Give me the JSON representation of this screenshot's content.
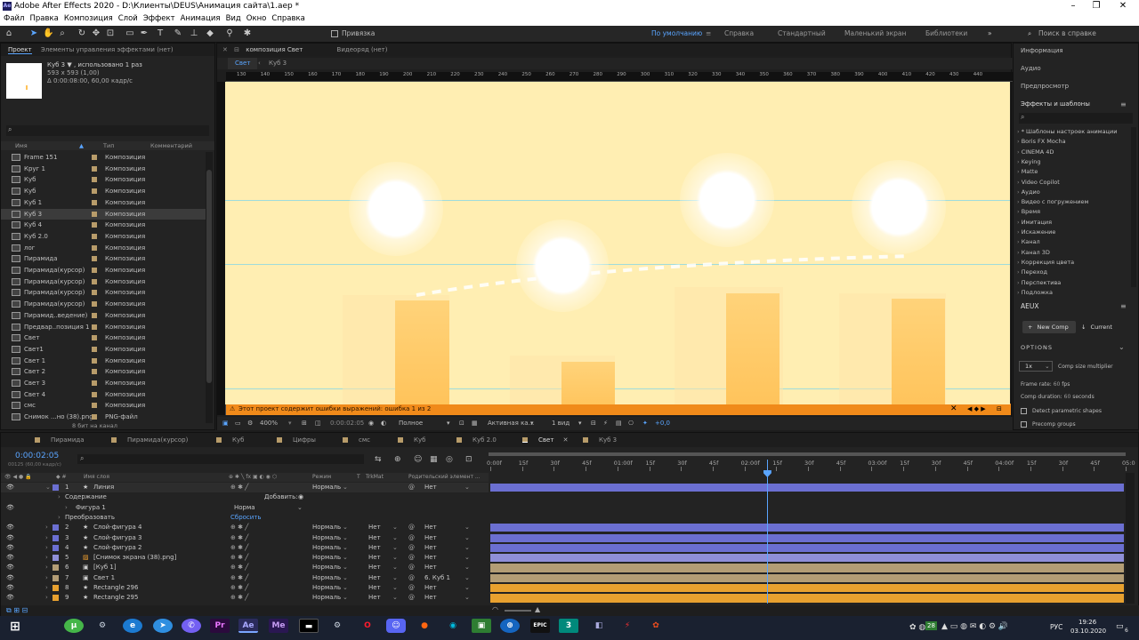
{
  "window": {
    "title": "Adobe After Effects 2020 - D:\\Клиенты\\DEUS\\Анимация сайта\\1.aep *"
  },
  "menu": [
    "Файл",
    "Правка",
    "Композиция",
    "Слой",
    "Эффект",
    "Анимация",
    "Вид",
    "Окно",
    "Справка"
  ],
  "toolbar": {
    "snap_label": "Привязка",
    "workspaces": [
      "По умолчанию",
      "Справка",
      "Стандартный",
      "Маленький экран",
      "Библиотеки"
    ],
    "search_placeholder": "Поиск в справке"
  },
  "project_panel": {
    "tabs": [
      "Проект",
      "Элементы управления эффектами (нет)"
    ],
    "selected_name": "Куб 3 ▼ , использовано 1 раз",
    "selected_dims": "593 x 593 (1,00)",
    "selected_duration": "Δ 0:00:08:00, 60,00 кадр/с",
    "columns": [
      "Имя",
      "Тип",
      "Комментарий"
    ],
    "items": [
      {
        "name": "Frame 151",
        "type": "Композиция"
      },
      {
        "name": "Круг 1",
        "type": "Композиция"
      },
      {
        "name": "Куб",
        "type": "Композиция"
      },
      {
        "name": "Куб",
        "type": "Композиция"
      },
      {
        "name": "Куб 1",
        "type": "Композиция"
      },
      {
        "name": "Куб 3",
        "type": "Композиция",
        "selected": true
      },
      {
        "name": "Куб 4",
        "type": "Композиция"
      },
      {
        "name": "Куб 2.0",
        "type": "Композиция"
      },
      {
        "name": "лог",
        "type": "Композиция"
      },
      {
        "name": "Пирамида",
        "type": "Композиция"
      },
      {
        "name": "Пирамида(курсор)",
        "type": "Композиция"
      },
      {
        "name": "Пирамида(курсор)",
        "type": "Композиция"
      },
      {
        "name": "Пирамида(курсор)",
        "type": "Композиция"
      },
      {
        "name": "Пирамида(курсор)",
        "type": "Композиция"
      },
      {
        "name": "Пирамид..ведение)",
        "type": "Композиция"
      },
      {
        "name": "Предвар..позиция 1",
        "type": "Композиция"
      },
      {
        "name": "Свет",
        "type": "Композиция"
      },
      {
        "name": "Свет1",
        "type": "Композиция"
      },
      {
        "name": "Свет 1",
        "type": "Композиция"
      },
      {
        "name": "Свет 2",
        "type": "Композиция"
      },
      {
        "name": "Свет 3",
        "type": "Композиция"
      },
      {
        "name": "Свет 4",
        "type": "Композиция"
      },
      {
        "name": "смс",
        "type": "Композиция"
      },
      {
        "name": "Снимок ...но (38).png",
        "type": "PNG-файл"
      }
    ],
    "footer": "8 бит на канал"
  },
  "comp_panel": {
    "tabs": [
      "композиция Свет",
      "Видеоряд (нет)"
    ],
    "breadcrumbs": [
      "Свет",
      "Куб 3"
    ],
    "ruler": [
      "130",
      "140",
      "150",
      "160",
      "170",
      "180",
      "190",
      "200",
      "210",
      "220",
      "230",
      "240",
      "250",
      "260",
      "270",
      "280",
      "290",
      "300",
      "310",
      "320",
      "330",
      "340",
      "350",
      "360",
      "370",
      "380",
      "390",
      "400",
      "410",
      "420",
      "430",
      "440"
    ],
    "warning": "Этот проект содержит ошибки выражений: ошибка 1 из 2",
    "zoom": "400%",
    "time": "0:00:02:05",
    "quality": "Полное",
    "camera": "Активная ка...",
    "views": "1 вид",
    "exposure": "+0,0"
  },
  "right_panel": {
    "sections": [
      "Информация",
      "Аудио",
      "Предпросмотр",
      "Эффекты и шаблоны"
    ],
    "effects": [
      "* Шаблоны настроек анимации",
      "Boris FX Mocha",
      "CINEMA 4D",
      "Keying",
      "Matte",
      "Video Copilot",
      "Аудио",
      "Видео с погружением",
      "Время",
      "Имитация",
      "Искажение",
      "Канал",
      "Канал 3D",
      "Коррекция цвета",
      "Переход",
      "Перспектива",
      "Подложка"
    ],
    "aeux": {
      "title": "AEUX",
      "new_comp": "New Comp",
      "current": "Current",
      "options": "OPTIONS",
      "multiplier": "1x",
      "multiplier_label": "Comp size multiplier",
      "frame_rate_label": "Frame rate:",
      "frame_rate": "60",
      "frame_rate_unit": "fps",
      "duration_label": "Comp duration:",
      "duration": "60",
      "duration_unit": "seconds",
      "detect": "Detect parametric shapes",
      "precomp": "Precomp groups"
    }
  },
  "timeline": {
    "tabs": [
      "Пирамида",
      "Пирамида(курсор)",
      "Куб",
      "Цифры",
      "смс",
      "Куб",
      "Куб 2.0",
      "Свет",
      "Куб 3"
    ],
    "active_tab": "Свет",
    "current_time": "0:00:02:05",
    "frame_info": "00125 (60,00 кадр/с)",
    "columns": [
      "Имя слоя",
      "Режим",
      "T",
      "TrkMat",
      "Родительский элемент ..."
    ],
    "ticks": [
      "0:00f",
      "15f",
      "30f",
      "45f",
      "01:00f",
      "15f",
      "30f",
      "45f",
      "02:00f",
      "15f",
      "30f",
      "45f",
      "03:00f",
      "15f",
      "30f",
      "45f",
      "04:00f",
      "15f",
      "30f",
      "45f",
      "05:0"
    ],
    "playhead_fraction": 0.4354,
    "layers": [
      {
        "n": "1",
        "name": "Линия",
        "mode": "Нормаль",
        "trk": "",
        "parent": "Нет",
        "color": "#6b6fd1",
        "star": true,
        "expanded": true
      },
      {
        "n": "",
        "name": "Содержание",
        "sub": true,
        "add": "Добавить:"
      },
      {
        "n": "",
        "name": "Фигура 1",
        "sub2": true,
        "mode": "Норма"
      },
      {
        "n": "",
        "name": "Преобразовать",
        "sub": true,
        "mode": "Сбросить"
      },
      {
        "n": "2",
        "name": "Слой-фигура 4",
        "mode": "Нормаль",
        "trk": "Нет",
        "parent": "Нет",
        "color": "#6b6fd1",
        "star": true
      },
      {
        "n": "3",
        "name": "Слой-фигура 3",
        "mode": "Нормаль",
        "trk": "Нет",
        "parent": "Нет",
        "color": "#6b6fd1",
        "star": true
      },
      {
        "n": "4",
        "name": "Слой-фигура 2",
        "mode": "Нормаль",
        "trk": "Нет",
        "parent": "Нет",
        "color": "#6b6fd1",
        "star": true
      },
      {
        "n": "5",
        "name": "[Снимок экрана (38).png]",
        "mode": "Нормаль",
        "trk": "Нет",
        "parent": "Нет",
        "color": "#8f8fd8",
        "img": true
      },
      {
        "n": "6",
        "name": "[Куб 1]",
        "mode": "Нормаль",
        "trk": "Нет",
        "parent": "Нет",
        "color": "#b39d75",
        "comp": true
      },
      {
        "n": "7",
        "name": "Свет 1",
        "mode": "Нормаль",
        "trk": "Нет",
        "parent": "6. Куб 1",
        "color": "#b39d75",
        "comp": true
      },
      {
        "n": "8",
        "name": "Rectangle 296",
        "mode": "Нормаль",
        "trk": "Нет",
        "parent": "Нет",
        "color": "#e8a12f",
        "star": true
      },
      {
        "n": "9",
        "name": "Rectangle 295",
        "mode": "Нормаль",
        "trk": "Нет",
        "parent": "Нет",
        "color": "#e8a12f",
        "star": true
      }
    ]
  },
  "taskbar": {
    "time": "19:26",
    "date": "03.10.2020",
    "lang": "РУС",
    "badge": "28",
    "notif": "6"
  },
  "colors": {
    "accent": "#2d8ceb",
    "warning": "#f08a1a",
    "canvas": "#ffeeb2",
    "bar": "#ffc35a",
    "label_blue": "#6b6fd1",
    "label_tan": "#b39d75",
    "label_orange": "#e8a12f"
  }
}
